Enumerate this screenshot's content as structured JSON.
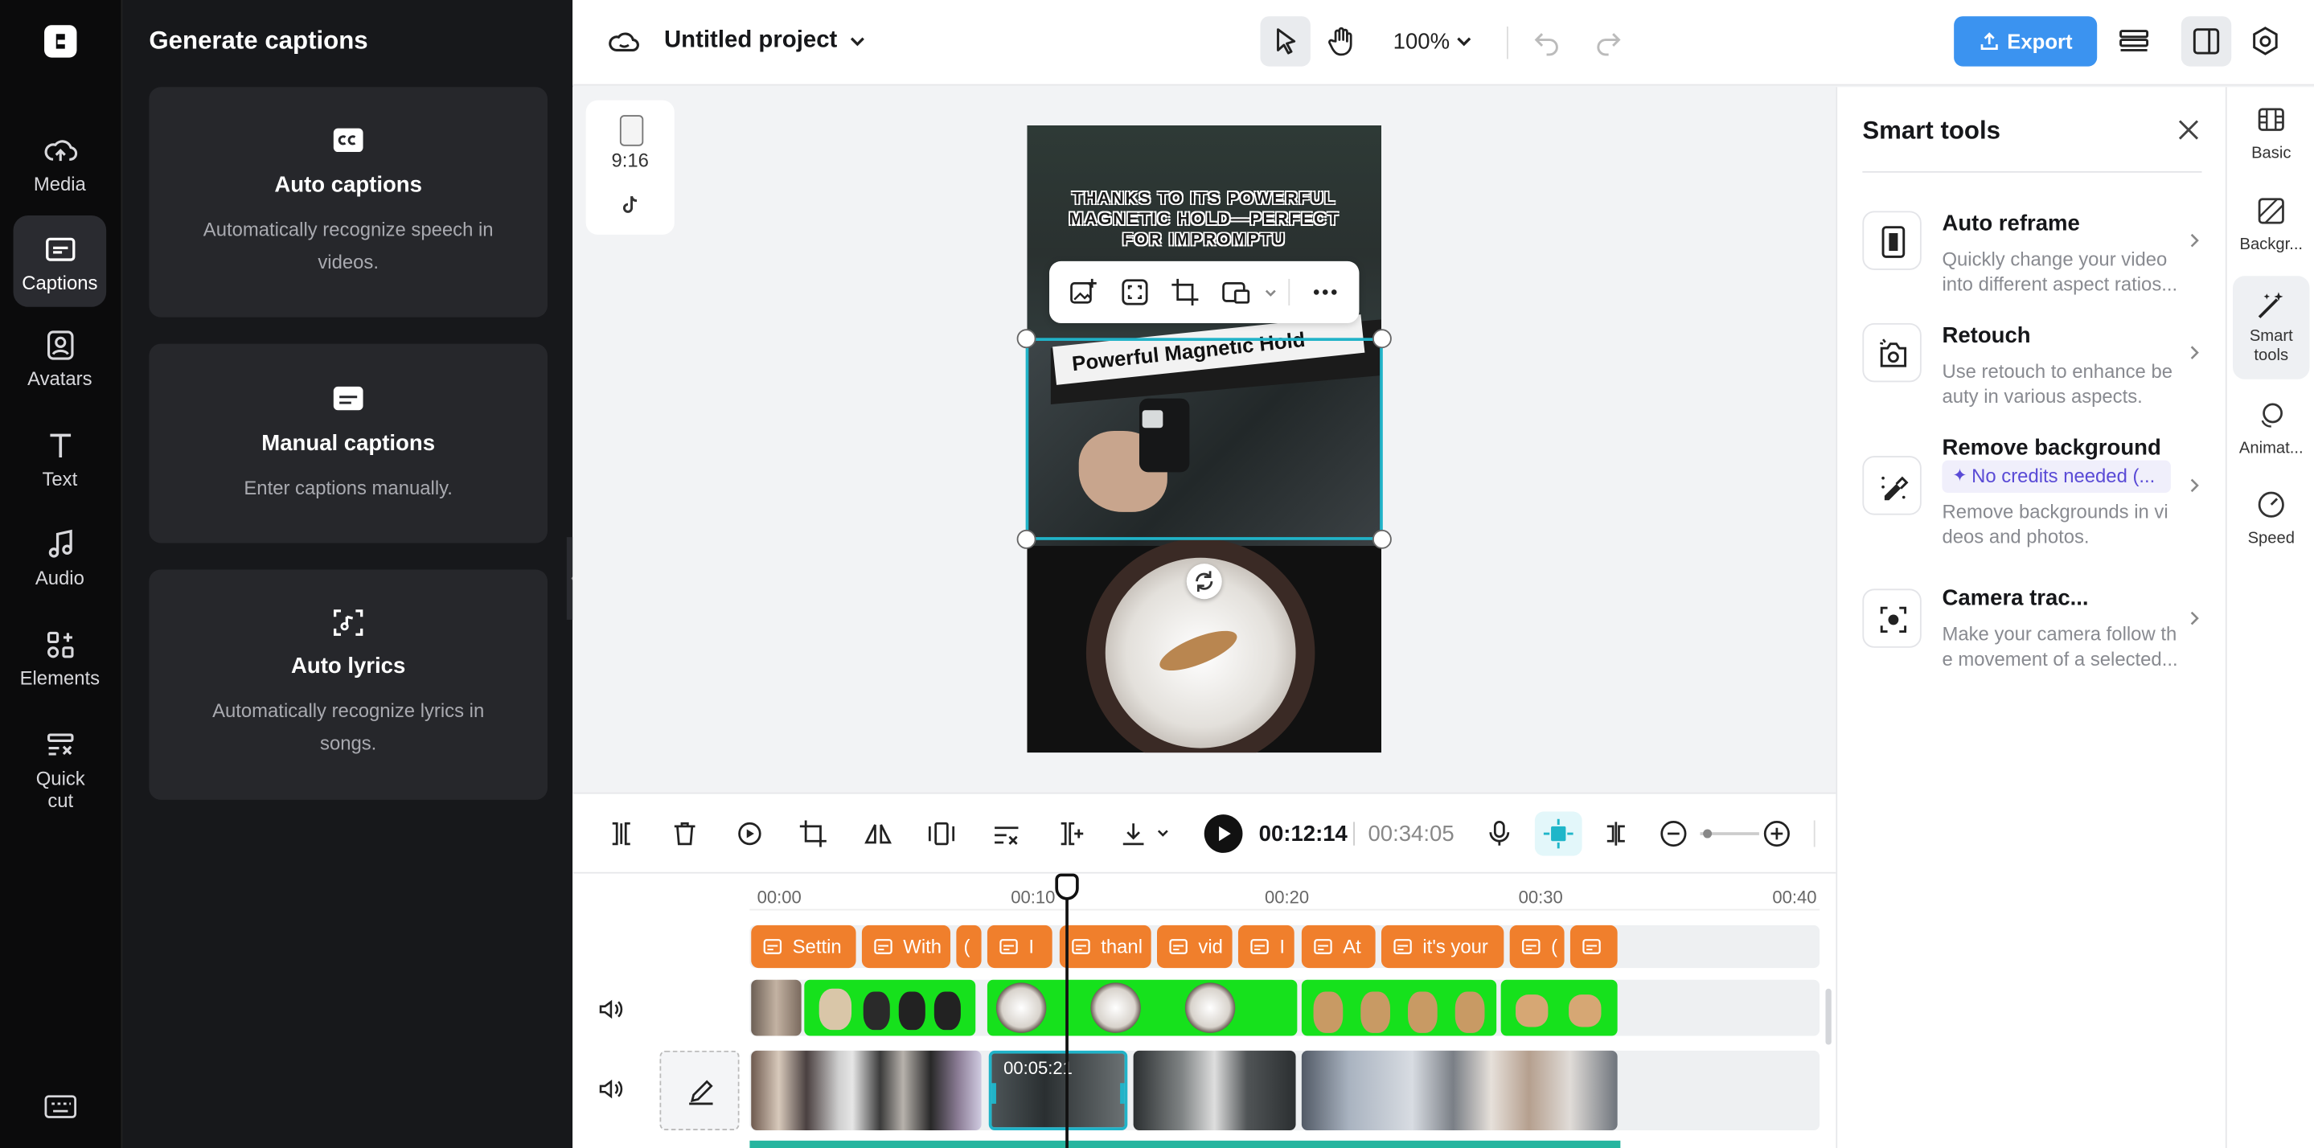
{
  "rail": {
    "items": [
      {
        "label": "Media",
        "icon": "cloud-upload-icon"
      },
      {
        "label": "Captions",
        "icon": "captions-icon",
        "active": true
      },
      {
        "label": "Avatars",
        "icon": "avatar-icon"
      },
      {
        "label": "Text",
        "icon": "text-icon"
      },
      {
        "label": "Audio",
        "icon": "music-note-icon"
      },
      {
        "label": "Elements",
        "icon": "elements-icon"
      },
      {
        "label": "Quick cut",
        "icon": "quick-cut-icon"
      }
    ]
  },
  "captions_panel": {
    "title": "Generate captions",
    "cards": [
      {
        "title": "Auto captions",
        "desc": "Automatically recognize speech in videos.",
        "icon": "cc-icon"
      },
      {
        "title": "Manual captions",
        "desc": "Enter captions manually.",
        "icon": "subtitle-icon"
      },
      {
        "title": "Auto lyrics",
        "desc": "Automatically recognize lyrics in songs.",
        "icon": "lyrics-icon"
      }
    ]
  },
  "topbar": {
    "project_title": "Untitled project",
    "zoom": "100%",
    "export_label": "Export",
    "accent": "#3b93f0"
  },
  "canvas": {
    "ratio": "9:16",
    "video_text_top": "THANKS TO ITS POWERFUL MAGNETIC HOLD—PERFECT FOR IMPROMPTU",
    "video_text_banner": "Powerful Magnetic Hold"
  },
  "smart_tools": {
    "title": "Smart tools",
    "items": [
      {
        "name": "Auto reframe",
        "desc": "Quickly change your video into different aspect ratios..."
      },
      {
        "name": "Retouch",
        "desc": "Use retouch to enhance be auty in various aspects."
      },
      {
        "name": "Remove background",
        "badge": "No credits needed (...",
        "desc": "Remove backgrounds in vi deos and photos."
      },
      {
        "name": "Camera trac...",
        "desc": "Make your camera follow th e movement of a selected..."
      }
    ]
  },
  "right_rail": {
    "items": [
      {
        "label": "Basic"
      },
      {
        "label": "Backgr..."
      },
      {
        "label": "Smart tools",
        "active": true
      },
      {
        "label": "Animat..."
      },
      {
        "label": "Speed"
      }
    ]
  },
  "player": {
    "current_time": "00:12:14",
    "total_time": "00:34:05"
  },
  "timeline": {
    "ticks": [
      "00:00",
      "00:10",
      "00:20",
      "00:30",
      "00:40"
    ],
    "captions": [
      "Settin",
      "With",
      "(",
      "I",
      "thanl",
      "vid",
      "I",
      "At",
      "it's your",
      "(",
      ""
    ],
    "selected_clip_time": "00:05:21",
    "green": "#16e11c",
    "orange": "#f07f2c"
  }
}
